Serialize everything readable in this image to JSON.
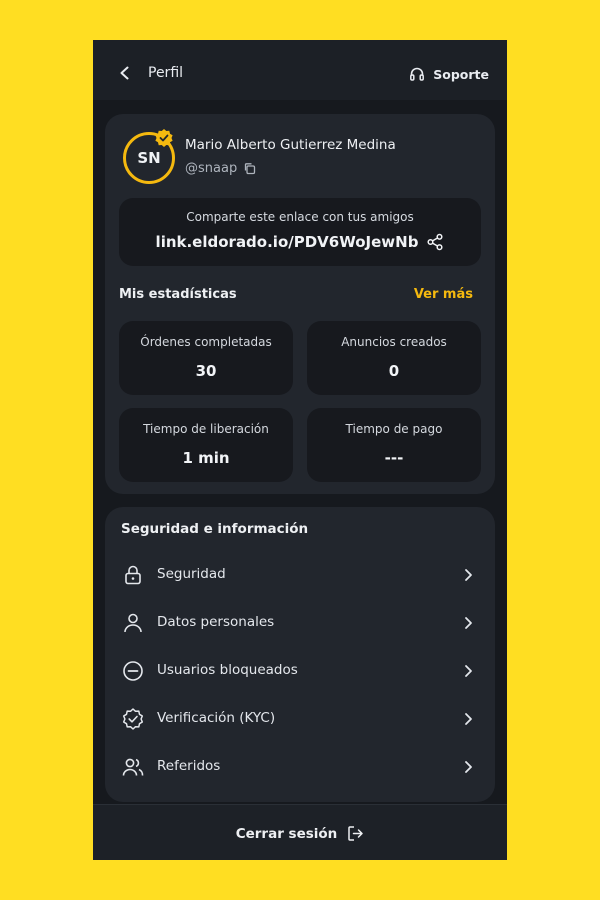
{
  "header": {
    "title": "Perfil",
    "support_label": "Soporte"
  },
  "profile": {
    "initials": "SN",
    "name": "Mario Alberto Gutierrez Medina",
    "handle": "@snaap"
  },
  "share": {
    "caption": "Comparte este enlace con tus amigos",
    "link": "link.eldorado.io/PDV6WoJewNb"
  },
  "stats": {
    "title": "Mis estadísticas",
    "see_more": "Ver más",
    "items": [
      {
        "label": "Órdenes completadas",
        "value": "30"
      },
      {
        "label": "Anuncios creados",
        "value": "0"
      },
      {
        "label": "Tiempo de liberación",
        "value": "1 min"
      },
      {
        "label": "Tiempo de pago",
        "value": "---"
      }
    ]
  },
  "security": {
    "title": "Seguridad e información",
    "items": [
      {
        "label": "Seguridad",
        "icon": "lock-icon"
      },
      {
        "label": "Datos personales",
        "icon": "user-icon"
      },
      {
        "label": "Usuarios bloqueados",
        "icon": "block-icon"
      },
      {
        "label": "Verificación (KYC)",
        "icon": "verified-badge-icon"
      },
      {
        "label": "Referidos",
        "icon": "users-icon"
      }
    ]
  },
  "footer": {
    "logout_label": "Cerrar sesión"
  },
  "colors": {
    "accent": "#F5B90F",
    "background": "#FFDE22",
    "surface": "#22262D"
  }
}
